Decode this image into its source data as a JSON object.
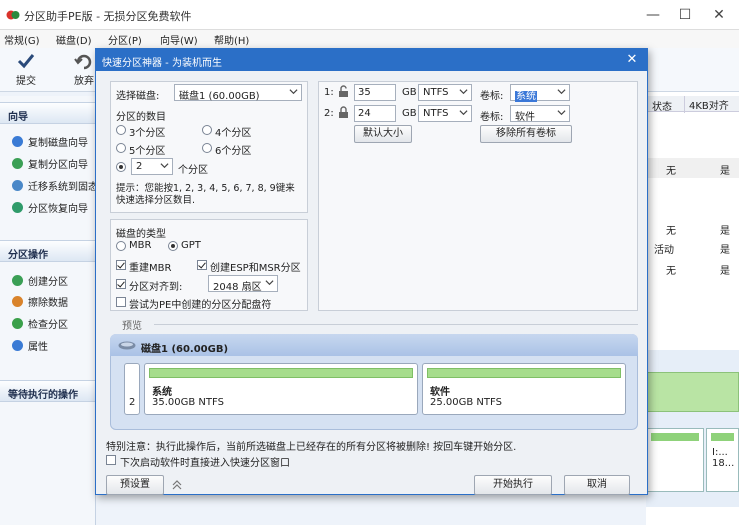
{
  "app": {
    "title": "分区助手PE版 - 无损分区免费软件",
    "minimize": "—",
    "maximize": "☐",
    "close": "✕"
  },
  "menu": [
    "常规(G)",
    "磁盘(D)",
    "分区(P)",
    "向导(W)",
    "帮助(H)"
  ],
  "toolbar": {
    "submit": "提交",
    "discard": "放弃"
  },
  "sidebar": {
    "wizard_header": "向导",
    "wizard_items": [
      "复制磁盘向导",
      "复制分区向导",
      "迁移系统到固态",
      "分区恢复向导"
    ],
    "ops_header": "分区操作",
    "ops_items": [
      "创建分区",
      "擦除数据",
      "检查分区",
      "属性"
    ],
    "pending_header": "等待执行的操作"
  },
  "background_table": {
    "col_status": "状态",
    "col_align": "4KB对齐",
    "rows": [
      {
        "status": "无",
        "align": "是"
      },
      {
        "status": "无",
        "align": "是"
      },
      {
        "status": "活动",
        "align": "是"
      },
      {
        "status": "无",
        "align": "是"
      }
    ],
    "tile_text_1": "I:...",
    "tile_text_2": "18..."
  },
  "dialog": {
    "title": "快速分区神器 - 为装机而生",
    "close": "✕",
    "select_disk_label": "选择磁盘:",
    "select_disk_value": "磁盘1 (60.00GB)",
    "partition_count_label": "分区的数目",
    "options": {
      "p3": "3个分区",
      "p4": "4个分区",
      "p5": "5个分区",
      "p6": "6个分区",
      "custom_value": "2",
      "custom_suffix": "个分区"
    },
    "tip": "提示：您能按1, 2, 3, 4, 5, 6, 7, 8, 9键来快速选择分区数目.",
    "disk_type_label": "磁盘的类型",
    "mbr": "MBR",
    "gpt": "GPT",
    "rebuild_mbr": "重建MBR",
    "create_esp_msr": "创建ESP和MSR分区",
    "align_label": "分区对齐到:",
    "align_value": "2048 扇区",
    "try_pe": "尝试为PE中创建的分区分配盘符",
    "partitions": [
      {
        "index": "1:",
        "size": "35",
        "unit": "GB",
        "fs": "NTFS",
        "vol_label": "卷标:",
        "vol_value": "系统"
      },
      {
        "index": "2:",
        "size": "24",
        "unit": "GB",
        "fs": "NTFS",
        "vol_label": "卷标:",
        "vol_value": "软件"
      }
    ],
    "default_size_btn": "默认大小",
    "remove_labels_btn": "移除所有卷标",
    "preview_label": "预览",
    "preview_disk": "磁盘1 (60.00GB)",
    "preview_parts": [
      {
        "name": "系统",
        "detail": "35.00GB NTFS"
      },
      {
        "name": "软件",
        "detail": "25.00GB NTFS"
      }
    ],
    "preview_index": "2",
    "warning": "特别注意：执行此操作后，当前所选磁盘上已经存在的所有分区将被删除! 按回车键开始分区.",
    "next_boot": "下次启动软件时直接进入快速分区窗口",
    "preset_btn": "预设置",
    "start_btn": "开始执行",
    "cancel_btn": "取消"
  }
}
